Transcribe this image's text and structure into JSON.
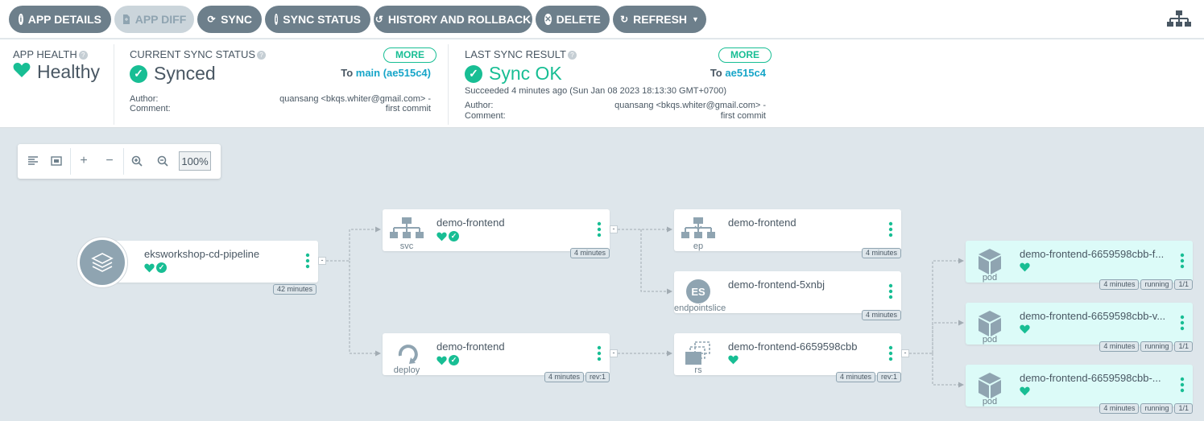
{
  "toolbar": {
    "buttons": [
      {
        "label": "APP DETAILS",
        "icon": "info-icon"
      },
      {
        "label": "APP DIFF",
        "icon": "file-icon"
      },
      {
        "label": "SYNC",
        "icon": "sync-icon"
      },
      {
        "label": "SYNC STATUS",
        "icon": "info-icon"
      },
      {
        "label": "HISTORY AND ROLLBACK",
        "icon": "history-icon"
      },
      {
        "label": "DELETE",
        "icon": "delete-icon"
      },
      {
        "label": "REFRESH",
        "icon": "refresh-icon"
      }
    ]
  },
  "status": {
    "health": {
      "title": "APP HEALTH",
      "value": "Healthy"
    },
    "current_sync": {
      "title": "CURRENT SYNC STATUS",
      "value": "Synced",
      "more": "MORE",
      "to_prefix": "To",
      "to_rev": "main (ae515c4)",
      "author_label": "Author:",
      "author_value_1": "quansang <bkqs.whiter@gmail.com> -",
      "comment_label": "Comment:",
      "comment_value": "first commit"
    },
    "last_sync": {
      "title": "LAST SYNC RESULT",
      "value": "Sync OK",
      "more": "MORE",
      "to_prefix": "To",
      "to_rev": "ae515c4",
      "succeeded": "Succeeded 4 minutes ago (Sun Jan 08 2023 18:13:30 GMT+0700)",
      "author_label": "Author:",
      "author_value_1": "quansang <bkqs.whiter@gmail.com> -",
      "comment_label": "Comment:",
      "comment_value": "first commit"
    }
  },
  "graph_controls": {
    "zoom": "100%"
  },
  "nodes": {
    "app": {
      "name": "eksworkshop-cd-pipeline",
      "age": "42 minutes"
    },
    "svc": {
      "kind": "svc",
      "name": "demo-frontend",
      "age": "4 minutes"
    },
    "deploy": {
      "kind": "deploy",
      "name": "demo-frontend",
      "age": "4 minutes",
      "rev": "rev:1"
    },
    "ep": {
      "kind": "ep",
      "name": "demo-frontend",
      "age": "4 minutes"
    },
    "eps": {
      "kind": "endpointslice",
      "badge": "ES",
      "name": "demo-frontend-5xnbj",
      "age": "4 minutes"
    },
    "rs": {
      "kind": "rs",
      "name": "demo-frontend-6659598cbb",
      "age": "4 minutes",
      "rev": "rev:1"
    },
    "pods": [
      {
        "kind": "pod",
        "name": "demo-frontend-6659598cbb-f...",
        "age": "4 minutes",
        "state": "running",
        "ready": "1/1"
      },
      {
        "kind": "pod",
        "name": "demo-frontend-6659598cbb-v...",
        "age": "4 minutes",
        "state": "running",
        "ready": "1/1"
      },
      {
        "kind": "pod",
        "name": "demo-frontend-6659598cbb-...",
        "age": "4 minutes",
        "state": "running",
        "ready": "1/1"
      }
    ]
  },
  "colors": {
    "accent": "#18be94",
    "button": "#6d7f8b",
    "link": "#16a5c8",
    "pod_bg": "#dcfbf8"
  }
}
